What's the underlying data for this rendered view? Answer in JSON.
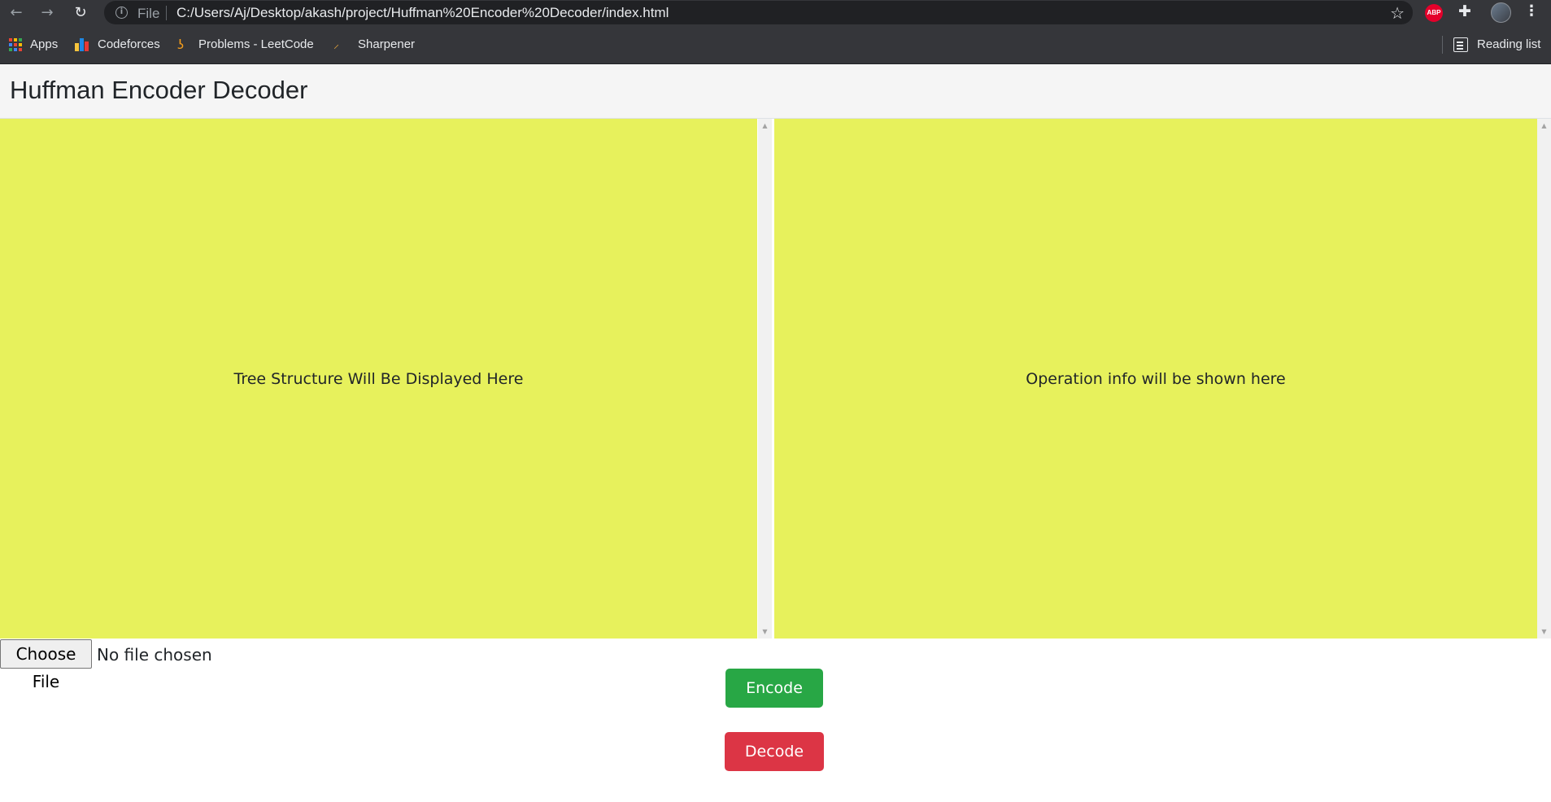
{
  "browser": {
    "back_icon": "arrow-left-icon",
    "forward_icon": "arrow-right-icon",
    "reload_icon": "reload-icon",
    "scheme_label": "File",
    "url": "C:/Users/Aj/Desktop/akash/project/Huffman%20Encoder%20Decoder/index.html",
    "abp_label": "ABP",
    "bookmarks": [
      {
        "label": "Apps",
        "icon": "apps-grid-icon"
      },
      {
        "label": "Codeforces",
        "icon": "codeforces-icon"
      },
      {
        "label": "Problems - LeetCode",
        "icon": "leetcode-icon"
      },
      {
        "label": "Sharpener",
        "icon": "sharpener-icon"
      }
    ],
    "reading_list_label": "Reading list"
  },
  "page": {
    "title": "Huffman Encoder Decoder",
    "tree_panel_text": "Tree Structure Will Be Displayed Here",
    "info_panel_text": "Operation info will be shown here",
    "file_button_label": "Choose File",
    "file_status": "No file chosen",
    "encode_label": "Encode",
    "decode_label": "Decode"
  },
  "colors": {
    "panel_background": "#e7f15c",
    "encode_button": "#28a745",
    "decode_button": "#dc3545",
    "browser_chrome": "#35363a"
  }
}
